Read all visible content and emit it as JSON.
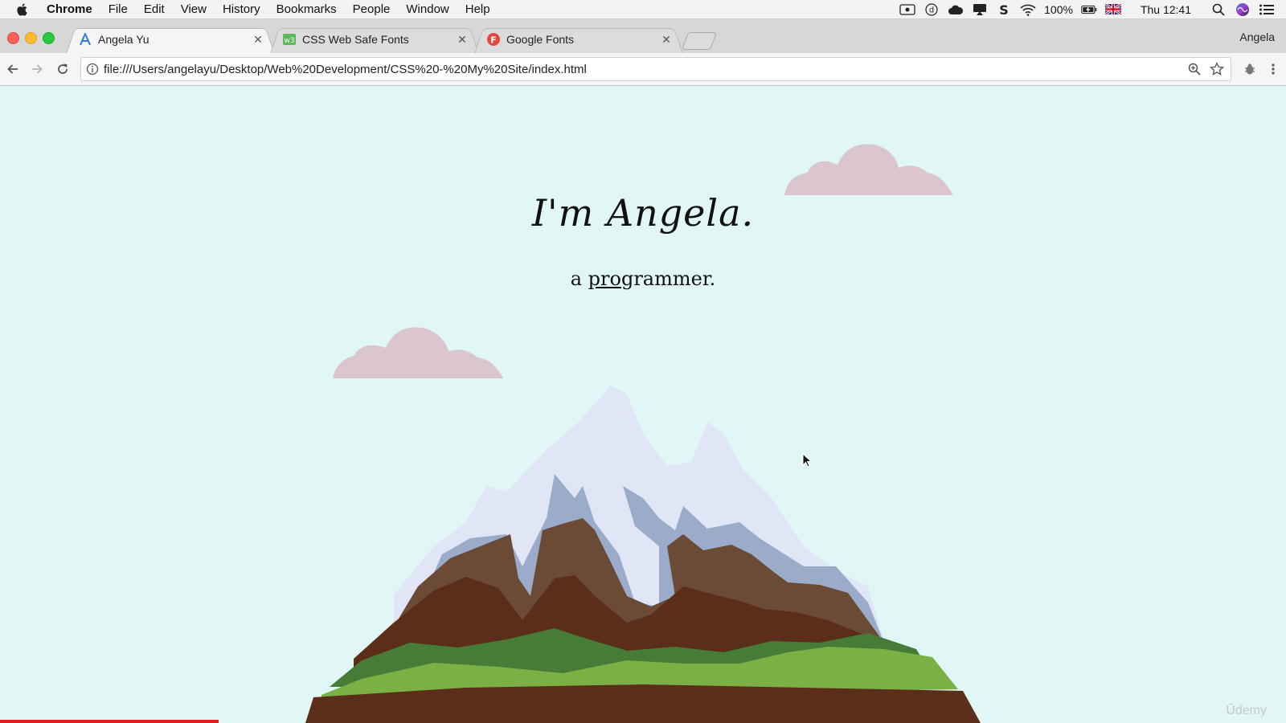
{
  "menubar": {
    "app": "Chrome",
    "items": [
      "File",
      "Edit",
      "View",
      "History",
      "Bookmarks",
      "People",
      "Window",
      "Help"
    ],
    "battery": "100%",
    "clock": "Thu 12:41"
  },
  "tabs": [
    {
      "label": "Angela Yu",
      "favicon": "angela-favicon-icon",
      "active": true
    },
    {
      "label": "CSS Web Safe Fonts",
      "favicon": "css-fonts-favicon-icon",
      "active": false
    },
    {
      "label": "Google Fonts",
      "favicon": "google-fonts-favicon-icon",
      "active": false
    }
  ],
  "profile_name": "Angela",
  "address_bar": {
    "url": "file:///Users/angelayu/Desktop/Web%20Development/CSS%20-%20My%20Site/index.html"
  },
  "page": {
    "heading": "I'm Angela.",
    "subtitle_prefix": "a ",
    "subtitle_underlined": "pro",
    "subtitle_suffix": "grammer."
  },
  "watermark": "Ūdemy",
  "video_progress": 0.17,
  "colors": {
    "background": "#e0f7f5",
    "cloud": "#dbc6d0",
    "snow": "#e0e6f5",
    "rock_blue": "#9aacca",
    "mountain_brown": "#6b4a36",
    "mountain_dark_brown": "#5a2e18",
    "grass_dark": "#467b38",
    "grass_light": "#7bb045",
    "progress": "#e02020"
  }
}
